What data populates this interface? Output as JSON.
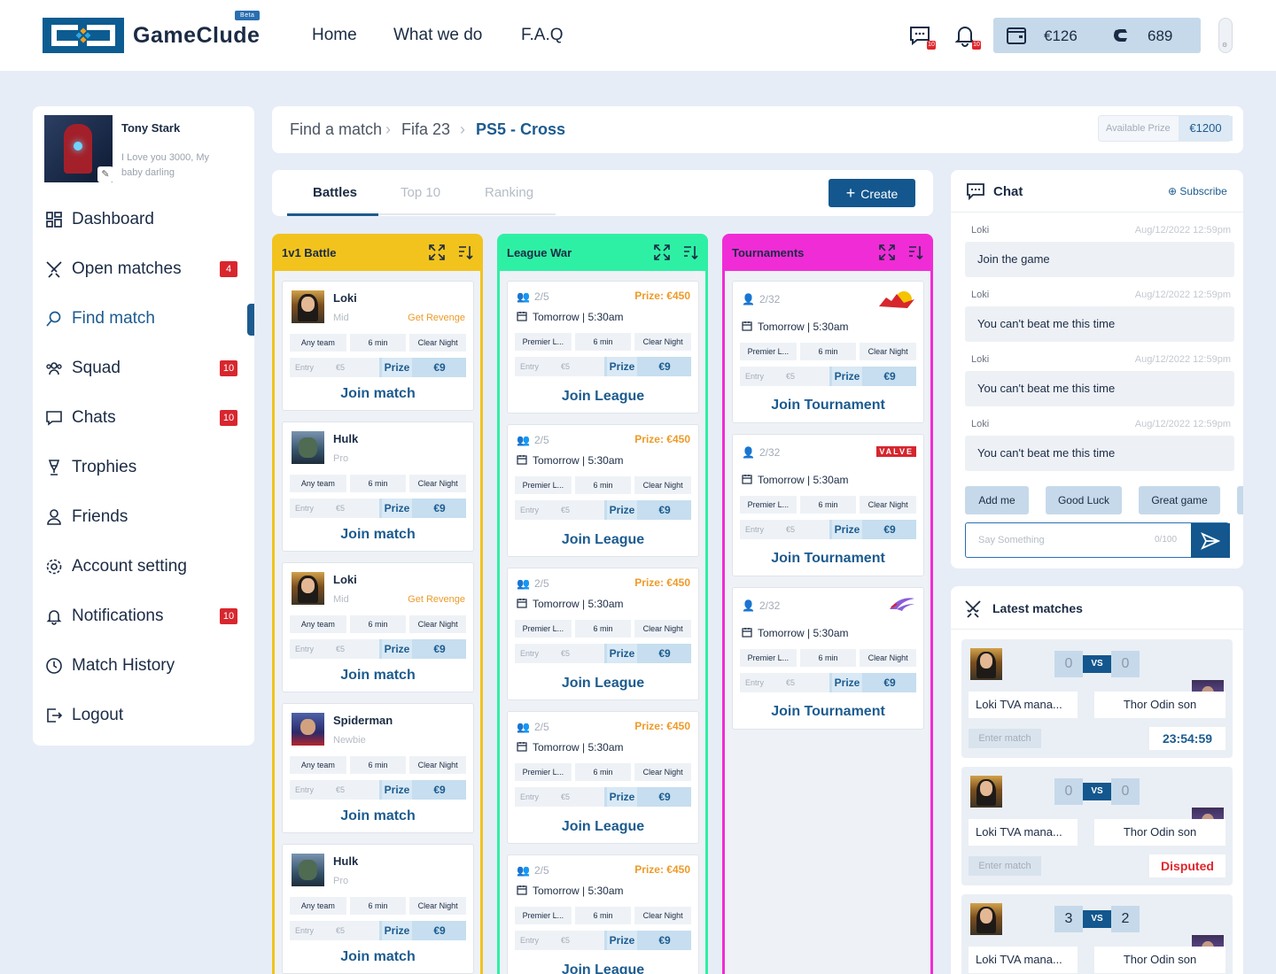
{
  "header": {
    "brand": "GameClude",
    "beta": "Beta",
    "nav": [
      "Home",
      "What we do",
      "F.A.Q"
    ],
    "chat_badge": "10",
    "notif_badge": "10",
    "wallet_balance": "€126",
    "coins": "689",
    "colors": {
      "brand": "#0c5c91",
      "accent": "#1c5b8f"
    }
  },
  "profile": {
    "name": "Tony Stark",
    "bio": "I Love you 3000, My baby darling"
  },
  "sidebar": {
    "items": [
      {
        "label": "Dashboard",
        "icon": "dashboard-icon",
        "badge": ""
      },
      {
        "label": "Open matches",
        "icon": "swords-icon",
        "badge": "4"
      },
      {
        "label": "Find match",
        "icon": "search-icon",
        "badge": ""
      },
      {
        "label": "Squad",
        "icon": "squad-icon",
        "badge": "10"
      },
      {
        "label": "Chats",
        "icon": "chat-icon",
        "badge": "10"
      },
      {
        "label": "Trophies",
        "icon": "trophy-icon",
        "badge": ""
      },
      {
        "label": "Friends",
        "icon": "user-icon",
        "badge": ""
      },
      {
        "label": "Account setting",
        "icon": "gear-icon",
        "badge": ""
      },
      {
        "label": "Notifications",
        "icon": "bell-icon",
        "badge": "10"
      },
      {
        "label": "Match History",
        "icon": "history-icon",
        "badge": ""
      },
      {
        "label": "Logout",
        "icon": "logout-icon",
        "badge": ""
      }
    ]
  },
  "breadcrumb": {
    "items": [
      "Find a match",
      "Fifa 23",
      "PS5 - Cross"
    ],
    "prize_label": "Available Prize",
    "prize_value": "€1200"
  },
  "tabs": {
    "items": [
      "Battles",
      "Top 10",
      "Ranking"
    ],
    "create": "Create"
  },
  "columns": {
    "battle": {
      "title": "1v1 Battle",
      "color": "#f2c31d"
    },
    "league": {
      "title": "League War",
      "color": "#2ef0a4"
    },
    "tourney": {
      "title": "Tournaments",
      "color": "#f02cd6"
    }
  },
  "battles": [
    {
      "name": "Loki",
      "rank": "Mid",
      "revenge": "Get Revenge",
      "team": "Any team",
      "time": "6 min",
      "map": "Clear Night",
      "entry": "Entry",
      "entry_val": "€5",
      "prize": "Prize",
      "prize_val": "€9",
      "join": "Join match"
    },
    {
      "name": "Hulk",
      "rank": "Pro",
      "revenge": "",
      "team": "Any team",
      "time": "6 min",
      "map": "Clear Night",
      "entry": "Entry",
      "entry_val": "€5",
      "prize": "Prize",
      "prize_val": "€9",
      "join": "Join match"
    },
    {
      "name": "Loki",
      "rank": "Mid",
      "revenge": "Get Revenge",
      "team": "Any team",
      "time": "6 min",
      "map": "Clear Night",
      "entry": "Entry",
      "entry_val": "€5",
      "prize": "Prize",
      "prize_val": "€9",
      "join": "Join match"
    },
    {
      "name": "Spiderman",
      "rank": "Newbie",
      "revenge": "",
      "team": "Any team",
      "time": "6 min",
      "map": "Clear Night",
      "entry": "Entry",
      "entry_val": "€5",
      "prize": "Prize",
      "prize_val": "€9",
      "join": "Join match"
    },
    {
      "name": "Hulk",
      "rank": "Pro",
      "revenge": "",
      "team": "Any team",
      "time": "6 min",
      "map": "Clear Night",
      "entry": "Entry",
      "entry_val": "€5",
      "prize": "Prize",
      "prize_val": "€9",
      "join": "Join match"
    }
  ],
  "leagues": [
    {
      "slots": "2/5",
      "prize": "Prize: €450",
      "date": "Tomorrow | 5:30am",
      "league": "Premier L...",
      "time": "6 min",
      "map": "Clear Night",
      "entry": "Entry",
      "entry_val": "€5",
      "prize_label": "Prize",
      "prize_val": "€9",
      "join": "Join League"
    },
    {
      "slots": "2/5",
      "prize": "Prize: €450",
      "date": "Tomorrow | 5:30am",
      "league": "Premier L...",
      "time": "6 min",
      "map": "Clear Night",
      "entry": "Entry",
      "entry_val": "€5",
      "prize_label": "Prize",
      "prize_val": "€9",
      "join": "Join League"
    },
    {
      "slots": "2/5",
      "prize": "Prize: €450",
      "date": "Tomorrow | 5:30am",
      "league": "Premier L...",
      "time": "6 min",
      "map": "Clear Night",
      "entry": "Entry",
      "entry_val": "€5",
      "prize_label": "Prize",
      "prize_val": "€9",
      "join": "Join League"
    },
    {
      "slots": "2/5",
      "prize": "Prize: €450",
      "date": "Tomorrow | 5:30am",
      "league": "Premier L...",
      "time": "6 min",
      "map": "Clear Night",
      "entry": "Entry",
      "entry_val": "€5",
      "prize_label": "Prize",
      "prize_val": "€9",
      "join": "Join League"
    },
    {
      "slots": "2/5",
      "prize": "Prize: €450",
      "date": "Tomorrow | 5:30am",
      "league": "Premier L...",
      "time": "6 min",
      "map": "Clear Night",
      "entry": "Entry",
      "entry_val": "€5",
      "prize_label": "Prize",
      "prize_val": "€9",
      "join": "Join League"
    }
  ],
  "tournaments": [
    {
      "slots": "2/32",
      "sponsor": "redbull-logo",
      "date": "Tomorrow | 5:30am",
      "league": "Premier L...",
      "time": "6 min",
      "map": "Clear Night",
      "entry": "Entry",
      "entry_val": "€5",
      "prize_label": "Prize",
      "prize_val": "€9",
      "join": "Join Tournament"
    },
    {
      "slots": "2/32",
      "sponsor": "VALVE",
      "date": "Tomorrow | 5:30am",
      "league": "Premier L...",
      "time": "6 min",
      "map": "Clear Night",
      "entry": "Entry",
      "entry_val": "€5",
      "prize_label": "Prize",
      "prize_val": "€9",
      "join": "Join Tournament"
    },
    {
      "slots": "2/32",
      "sponsor": "rog-logo",
      "date": "Tomorrow | 5:30am",
      "league": "Premier L...",
      "time": "6 min",
      "map": "Clear Night",
      "entry": "Entry",
      "entry_val": "€5",
      "prize_label": "Prize",
      "prize_val": "€9",
      "join": "Join Tournament"
    }
  ],
  "chat": {
    "title": "Chat",
    "subscribe": "Subscribe",
    "messages": [
      {
        "user": "Loki",
        "time": "Aug/12/2022 12:59pm",
        "text": "Join the game"
      },
      {
        "user": "Loki",
        "time": "Aug/12/2022 12:59pm",
        "text": "You can't beat me this time"
      },
      {
        "user": "Loki",
        "time": "Aug/12/2022 12:59pm",
        "text": "You can't beat me this time"
      },
      {
        "user": "Loki",
        "time": "Aug/12/2022 12:59pm",
        "text": "You can't beat me this time"
      }
    ],
    "quick": [
      "Add me",
      "Good Luck",
      "Great game"
    ],
    "placeholder": "Say Something",
    "counter": "0/100"
  },
  "latest": {
    "title": "Latest matches",
    "matches": [
      {
        "p1": "Loki TVA mana...",
        "p2": "Thor Odin son",
        "s1": "0",
        "s2": "0",
        "vs": "VS",
        "enter": "Enter match",
        "status": "23:54:59",
        "status_color": "#1c5b8f"
      },
      {
        "p1": "Loki TVA mana...",
        "p2": "Thor Odin son",
        "s1": "0",
        "s2": "0",
        "vs": "VS",
        "enter": "Enter match",
        "status": "Disputed",
        "status_color": "#e1262d"
      },
      {
        "p1": "Loki TVA mana...",
        "p2": "Thor Odin son",
        "s1": "3",
        "s2": "2",
        "vs": "VS",
        "enter": "",
        "status": "",
        "status_color": ""
      }
    ]
  }
}
